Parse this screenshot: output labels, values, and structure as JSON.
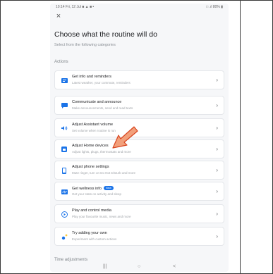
{
  "status_bar": {
    "left": "10:14  Fri, 12 Jul  ■ ▲ ■ •",
    "right": "□ .ıl 80% ▮"
  },
  "close_glyph": "×",
  "page_title": "Choose what the routine will do",
  "subtitle": "Select from the following categories",
  "section_actions": "Actions",
  "actions": [
    {
      "title": "Get info and reminders",
      "subtitle": "Latest weather, your commute, reminders",
      "icon": "info-icon",
      "badge": ""
    },
    {
      "title": "Communicate and announce",
      "subtitle": "Make announcements, send and read texts",
      "icon": "message-icon",
      "badge": ""
    },
    {
      "title": "Adjust Assistant volume",
      "subtitle": "Set volume when routine is run",
      "icon": "volume-icon",
      "badge": ""
    },
    {
      "title": "Adjust Home devices",
      "subtitle": "Adjust lights, plugs, thermostats and more",
      "icon": "home-icon",
      "badge": ""
    },
    {
      "title": "Adjust phone settings",
      "subtitle": "Mute ringer, turn on Do Not Disturb and more",
      "icon": "phone-icon",
      "badge": ""
    },
    {
      "title": "Get wellness info",
      "subtitle": "Get your stats on activity and sleep",
      "icon": "wellness-icon",
      "badge": "New"
    },
    {
      "title": "Play and control media",
      "subtitle": "Play your favourite music, news and more",
      "icon": "play-icon",
      "badge": ""
    },
    {
      "title": "Try adding your own",
      "subtitle": "Experiment with custom actions",
      "icon": "sparkle-icon",
      "badge": ""
    }
  ],
  "section_time": "Time adjustments",
  "nav": {
    "recents": "|||",
    "home": "○",
    "back": "<"
  },
  "chevron": "›",
  "colors": {
    "accent": "#1a73e8",
    "annotation_arrow": "#f2a07b",
    "annotation_outline": "#d9451f"
  }
}
